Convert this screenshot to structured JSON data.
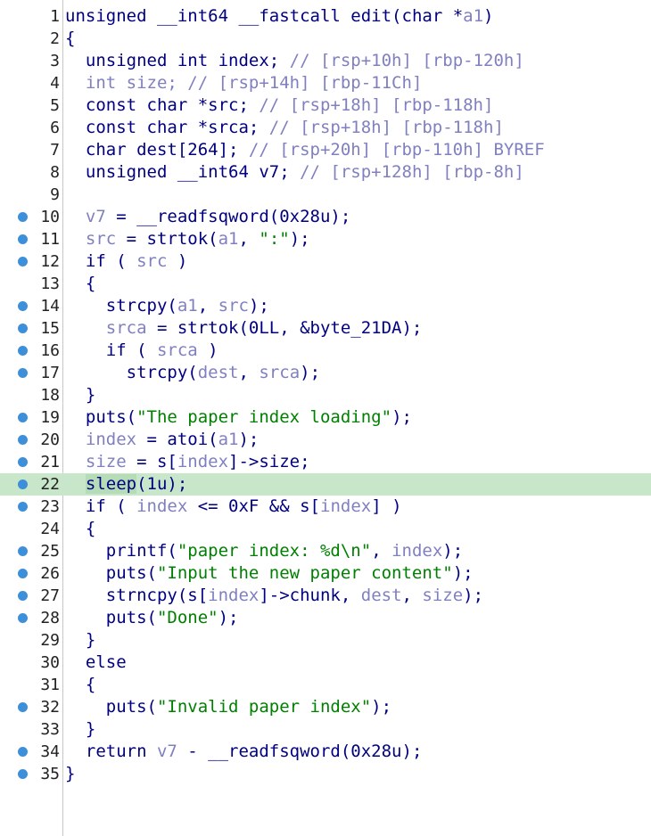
{
  "colors": {
    "background": "#ffffff",
    "line_highlight": "#c8e6c9",
    "breakpoint_dot": "#3d8fd9",
    "keyword_text": "#000080",
    "variable_text": "#8080c0",
    "string_text": "#008000"
  },
  "editor": {
    "highlighted_line": 22,
    "lines": [
      {
        "n": "1",
        "dot": false,
        "tokens": [
          [
            "tk-plain",
            "unsigned __int64 __fastcall edit("
          ],
          [
            "tk-plain",
            "char *"
          ],
          [
            "tk-var",
            "a1"
          ],
          [
            "tk-plain",
            ")"
          ]
        ]
      },
      {
        "n": "2",
        "dot": false,
        "tokens": [
          [
            "tk-plain",
            "{"
          ]
        ]
      },
      {
        "n": "3",
        "dot": false,
        "tokens": [
          [
            "tk-plain",
            "  unsigned int index; "
          ],
          [
            "tk-comment",
            "// [rsp+10h] [rbp-120h]"
          ]
        ]
      },
      {
        "n": "4",
        "dot": false,
        "tokens": [
          [
            "tk-var",
            "  int size; "
          ],
          [
            "tk-comment",
            "// [rsp+14h] [rbp-11Ch]"
          ]
        ]
      },
      {
        "n": "5",
        "dot": false,
        "tokens": [
          [
            "tk-plain",
            "  const char *src; "
          ],
          [
            "tk-comment",
            "// [rsp+18h] [rbp-118h]"
          ]
        ]
      },
      {
        "n": "6",
        "dot": false,
        "tokens": [
          [
            "tk-plain",
            "  const char *srca; "
          ],
          [
            "tk-comment",
            "// [rsp+18h] [rbp-118h]"
          ]
        ]
      },
      {
        "n": "7",
        "dot": false,
        "tokens": [
          [
            "tk-plain",
            "  char dest[264]; "
          ],
          [
            "tk-comment",
            "// [rsp+20h] [rbp-110h] BYREF"
          ]
        ]
      },
      {
        "n": "8",
        "dot": false,
        "tokens": [
          [
            "tk-plain",
            "  unsigned __int64 v7; "
          ],
          [
            "tk-comment",
            "// [rsp+128h] [rbp-8h]"
          ]
        ]
      },
      {
        "n": "9",
        "dot": false,
        "tokens": [
          [
            "tk-plain",
            ""
          ]
        ]
      },
      {
        "n": "10",
        "dot": true,
        "tokens": [
          [
            "tk-var",
            "  v7"
          ],
          [
            "tk-plain",
            " = __readfsqword(0x28u);"
          ]
        ]
      },
      {
        "n": "11",
        "dot": true,
        "tokens": [
          [
            "tk-var",
            "  src"
          ],
          [
            "tk-plain",
            " = strtok("
          ],
          [
            "tk-var",
            "a1"
          ],
          [
            "tk-plain",
            ", "
          ],
          [
            "tk-str",
            "\":\""
          ],
          [
            "tk-plain",
            ");"
          ]
        ]
      },
      {
        "n": "12",
        "dot": true,
        "tokens": [
          [
            "tk-plain",
            "  if ( "
          ],
          [
            "tk-var",
            "src"
          ],
          [
            "tk-plain",
            " )"
          ]
        ]
      },
      {
        "n": "13",
        "dot": false,
        "tokens": [
          [
            "tk-plain",
            "  {"
          ]
        ]
      },
      {
        "n": "14",
        "dot": true,
        "tokens": [
          [
            "tk-plain",
            "    strcpy("
          ],
          [
            "tk-var",
            "a1"
          ],
          [
            "tk-plain",
            ", "
          ],
          [
            "tk-var",
            "src"
          ],
          [
            "tk-plain",
            ");"
          ]
        ]
      },
      {
        "n": "15",
        "dot": true,
        "tokens": [
          [
            "tk-var",
            "    srca"
          ],
          [
            "tk-plain",
            " = strtok(0LL, &byte_21DA);"
          ]
        ]
      },
      {
        "n": "16",
        "dot": true,
        "tokens": [
          [
            "tk-plain",
            "    if ( "
          ],
          [
            "tk-var",
            "srca"
          ],
          [
            "tk-plain",
            " )"
          ]
        ]
      },
      {
        "n": "17",
        "dot": true,
        "tokens": [
          [
            "tk-plain",
            "      strcpy("
          ],
          [
            "tk-var",
            "dest"
          ],
          [
            "tk-plain",
            ", "
          ],
          [
            "tk-var",
            "srca"
          ],
          [
            "tk-plain",
            ");"
          ]
        ]
      },
      {
        "n": "18",
        "dot": false,
        "tokens": [
          [
            "tk-plain",
            "  }"
          ]
        ]
      },
      {
        "n": "19",
        "dot": true,
        "tokens": [
          [
            "tk-plain",
            "  puts("
          ],
          [
            "tk-str",
            "\"The paper index loading\""
          ],
          [
            "tk-plain",
            ");"
          ]
        ]
      },
      {
        "n": "20",
        "dot": true,
        "tokens": [
          [
            "tk-var",
            "  index"
          ],
          [
            "tk-plain",
            " = atoi("
          ],
          [
            "tk-var",
            "a1"
          ],
          [
            "tk-plain",
            ");"
          ]
        ]
      },
      {
        "n": "21",
        "dot": true,
        "tokens": [
          [
            "tk-var",
            "  size"
          ],
          [
            "tk-plain",
            " = s["
          ],
          [
            "tk-var",
            "index"
          ],
          [
            "tk-plain",
            "]->size;"
          ]
        ]
      },
      {
        "n": "22",
        "dot": true,
        "tokens": [
          [
            "tk-plain",
            "  "
          ],
          [
            "tk-hlfn",
            "sleep"
          ],
          [
            "tk-plain",
            "(1u);"
          ]
        ]
      },
      {
        "n": "23",
        "dot": true,
        "tokens": [
          [
            "tk-plain",
            "  if ( "
          ],
          [
            "tk-var",
            "index"
          ],
          [
            "tk-plain",
            " <= 0xF && s["
          ],
          [
            "tk-var",
            "index"
          ],
          [
            "tk-plain",
            "] )"
          ]
        ]
      },
      {
        "n": "24",
        "dot": false,
        "tokens": [
          [
            "tk-plain",
            "  {"
          ]
        ]
      },
      {
        "n": "25",
        "dot": true,
        "tokens": [
          [
            "tk-plain",
            "    printf("
          ],
          [
            "tk-str",
            "\"paper index: %d\\n\""
          ],
          [
            "tk-plain",
            ", "
          ],
          [
            "tk-var",
            "index"
          ],
          [
            "tk-plain",
            ");"
          ]
        ]
      },
      {
        "n": "26",
        "dot": true,
        "tokens": [
          [
            "tk-plain",
            "    puts("
          ],
          [
            "tk-str",
            "\"Input the new paper content\""
          ],
          [
            "tk-plain",
            ");"
          ]
        ]
      },
      {
        "n": "27",
        "dot": true,
        "tokens": [
          [
            "tk-plain",
            "    strncpy(s["
          ],
          [
            "tk-var",
            "index"
          ],
          [
            "tk-plain",
            "]->chunk, "
          ],
          [
            "tk-var",
            "dest"
          ],
          [
            "tk-plain",
            ", "
          ],
          [
            "tk-var",
            "size"
          ],
          [
            "tk-plain",
            ");"
          ]
        ]
      },
      {
        "n": "28",
        "dot": true,
        "tokens": [
          [
            "tk-plain",
            "    puts("
          ],
          [
            "tk-str",
            "\"Done\""
          ],
          [
            "tk-plain",
            ");"
          ]
        ]
      },
      {
        "n": "29",
        "dot": false,
        "tokens": [
          [
            "tk-plain",
            "  }"
          ]
        ]
      },
      {
        "n": "30",
        "dot": false,
        "tokens": [
          [
            "tk-plain",
            "  else"
          ]
        ]
      },
      {
        "n": "31",
        "dot": false,
        "tokens": [
          [
            "tk-plain",
            "  {"
          ]
        ]
      },
      {
        "n": "32",
        "dot": true,
        "tokens": [
          [
            "tk-plain",
            "    puts("
          ],
          [
            "tk-str",
            "\"Invalid paper index\""
          ],
          [
            "tk-plain",
            ");"
          ]
        ]
      },
      {
        "n": "33",
        "dot": false,
        "tokens": [
          [
            "tk-plain",
            "  }"
          ]
        ]
      },
      {
        "n": "34",
        "dot": true,
        "tokens": [
          [
            "tk-plain",
            "  return "
          ],
          [
            "tk-var",
            "v7"
          ],
          [
            "tk-plain",
            " - __readfsqword(0x28u);"
          ]
        ]
      },
      {
        "n": "35",
        "dot": true,
        "tokens": [
          [
            "tk-plain",
            "}"
          ]
        ]
      }
    ]
  }
}
